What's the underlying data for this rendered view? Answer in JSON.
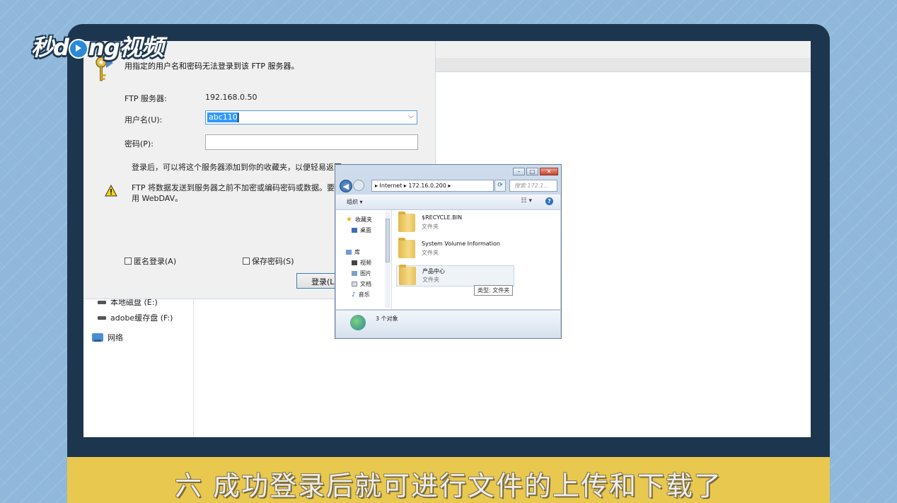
{
  "logo": {
    "text_before": "秒d",
    "text_after": "ng视频"
  },
  "login_dialog": {
    "message": "用指定的用户名和密码无法登录到该 FTP 服务器。",
    "server_label": "FTP 服务器:",
    "server_value": "192.168.0.50",
    "username_label": "用户名(U):",
    "username_value": "abc110",
    "password_label": "密码(P):",
    "info_text": "登录后，可以将这个服务器添加到你的收藏夹，以便轻易返回",
    "warning_line1": "FTP 将数据发送到服务器之前不加密或编码密码或数据。要保",
    "warning_line2": "用 WebDAV。",
    "anonymous_label": "匿名登录(A)",
    "save_password_label": "保存密码(S)",
    "login_button": "登录(L"
  },
  "background_nav": {
    "items": [
      {
        "label": "本地磁盘 (E:)",
        "icon": "drive-icon"
      },
      {
        "label": "adobe缓存盘 (F:)",
        "icon": "drive-icon"
      },
      {
        "label": "网络",
        "icon": "network-icon"
      }
    ]
  },
  "explorer": {
    "address_parts": [
      "Internet",
      "172.16.0.200"
    ],
    "address_text": "▸ Internet ▸ 172.16.0.200 ▸",
    "search_placeholder": "搜索 172.1...",
    "organize_label": "组织 ▾",
    "nav": {
      "favorites": "收藏夹",
      "desktop": "桌面",
      "library": "库",
      "videos": "视频",
      "pictures": "图片",
      "documents": "文档",
      "music": "音乐"
    },
    "files": [
      {
        "name": "$RECYCLE.BIN",
        "type": "文件夹"
      },
      {
        "name": "System Volume Information",
        "type": "文件夹"
      },
      {
        "name": "产品中心",
        "type": "文件夹"
      }
    ],
    "tooltip": "类型: 文件夹",
    "status_text": "3 个对象"
  },
  "subtitle": "六 成功登录后就可进行文件的上传和下载了",
  "colors": {
    "monitor_frame": "#1d3650",
    "subtitle_bar": "#e8c84f",
    "background": "#8fb8da",
    "selection": "#3399ff"
  }
}
